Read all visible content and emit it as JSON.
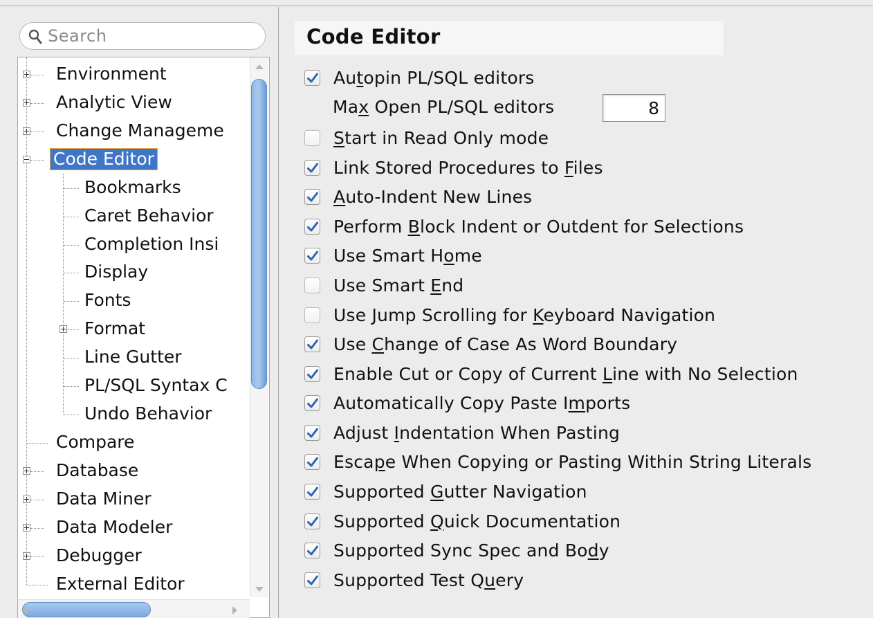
{
  "search": {
    "placeholder": "Search"
  },
  "tree": {
    "environment": "Environment",
    "analytic_view": "Analytic View",
    "change_management": "Change Manageme",
    "code_editor": "Code Editor",
    "bookmarks": "Bookmarks",
    "caret_behavior": "Caret Behavior",
    "completion_insight": "Completion Insi",
    "display": "Display",
    "fonts": "Fonts",
    "format": "Format",
    "line_gutter": "Line Gutter",
    "plsql_syntax": "PL/SQL Syntax C",
    "undo_behavior": "Undo Behavior",
    "compare": "Compare",
    "database": "Database",
    "data_miner": "Data Miner",
    "data_modeler": "Data Modeler",
    "debugger": "Debugger",
    "external_editor": "External Editor"
  },
  "page": {
    "title": "Code Editor"
  },
  "options": {
    "autopin": {
      "pre": "Au",
      "mn": "t",
      "post": "opin PL/SQL editors",
      "checked": true
    },
    "max_open": {
      "pre": "Ma",
      "mn": "x",
      "post": " Open PL/SQL editors",
      "value": "8"
    },
    "read_only": {
      "pre": "",
      "mn": "S",
      "post": "tart in Read Only mode",
      "checked": false
    },
    "link_stored": {
      "pre": "Link Stored Procedures to ",
      "mn": "F",
      "post": "iles",
      "checked": true
    },
    "auto_indent": {
      "pre": "",
      "mn": "A",
      "post": "uto-Indent New Lines",
      "checked": true
    },
    "block_indent": {
      "pre": "Perform ",
      "mn": "B",
      "post": "lock Indent or Outdent for Selections",
      "checked": true
    },
    "smart_home": {
      "pre": "Use Smart H",
      "mn": "o",
      "post": "me",
      "checked": true
    },
    "smart_end": {
      "pre": "Use Smart ",
      "mn": "E",
      "post": "nd",
      "checked": false
    },
    "jump_scrolling": {
      "pre": "Use Jump Scrolling for ",
      "mn": "K",
      "post": "eyboard Navigation",
      "checked": false
    },
    "change_case": {
      "pre": "Use ",
      "mn": "C",
      "post": "hange of Case As Word Boundary",
      "checked": true
    },
    "cut_copy_line": {
      "pre": "Enable Cut or Copy of Current ",
      "mn": "L",
      "post": "ine with No Selection",
      "checked": true
    },
    "copy_paste_imports": {
      "pre": "Automatically Copy Paste I",
      "mn": "m",
      "post": "ports",
      "checked": true
    },
    "adjust_indent": {
      "pre": "Adjust ",
      "mn": "I",
      "post": "ndentation When Pasting",
      "checked": true
    },
    "escape_literals": {
      "pre": "Esca",
      "mn": "p",
      "post": "e When Copying or Pasting Within String Literals",
      "checked": true
    },
    "gutter_nav": {
      "pre": "Supported ",
      "mn": "G",
      "post": "utter Navigation",
      "checked": true
    },
    "quick_doc": {
      "pre": "Supported ",
      "mn": "Q",
      "post": "uick Documentation",
      "checked": true
    },
    "sync_spec": {
      "pre": "Supported Sync Spec and Bo",
      "mn": "d",
      "post": "y",
      "checked": true
    },
    "test_query": {
      "pre": "Supported Test Q",
      "mn": "u",
      "post": "ery",
      "checked": true
    }
  },
  "colors": {
    "selection": "#3f76c8",
    "selection_border": "#e6a43a",
    "checkmark": "#2f63b5",
    "scroll_thumb": "#8fb7e6"
  },
  "icons": {
    "search": "magnifier-icon",
    "expand": "plus-box-icon",
    "collapse": "minus-box-icon",
    "check": "checkmark-icon"
  }
}
